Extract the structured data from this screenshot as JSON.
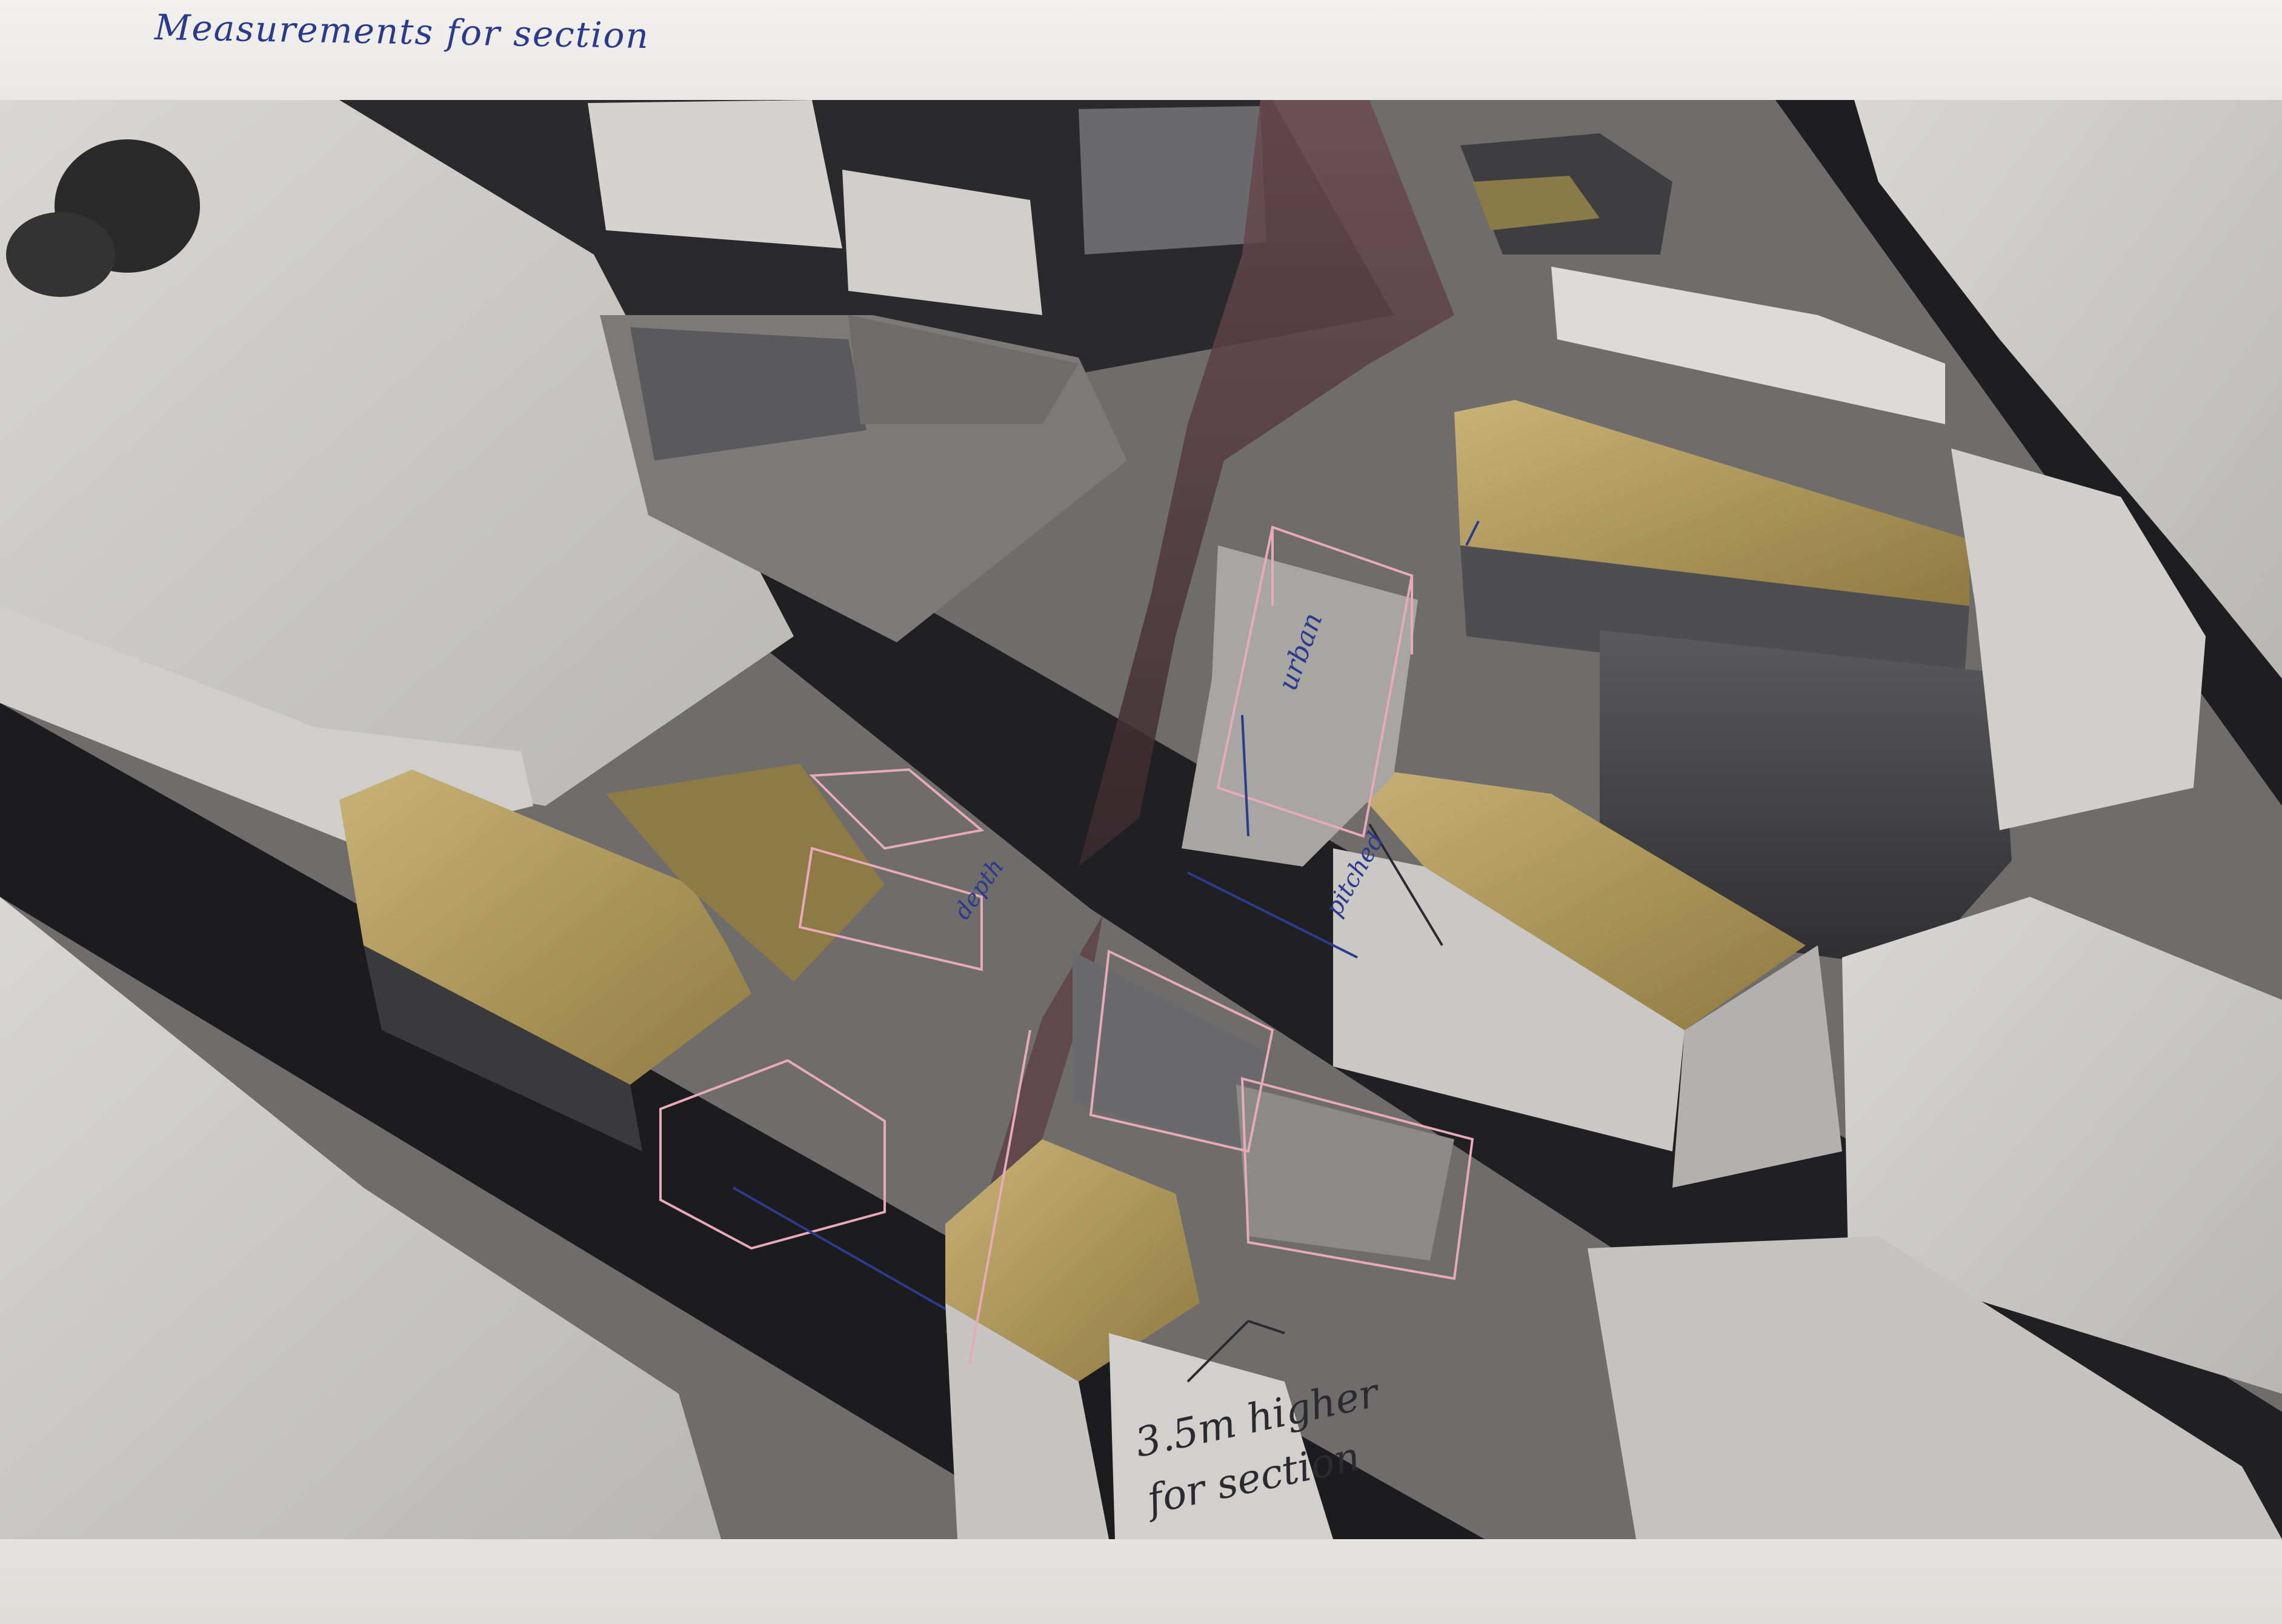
{
  "handwriting": {
    "title": "Measurements for section",
    "height_note": "3.5m higher for section",
    "dimension_urban": "urban",
    "dimension_depth": "depth",
    "dimension_angle": "pitched"
  },
  "colors": {
    "paper": "#ecebe8",
    "road": "#1c1c1e",
    "building_light": "#c9c8c5",
    "building_mid": "#8e8d8a",
    "building_dark": "#3a3a3c",
    "roof_highlight": "#b39a55",
    "lane_tint": "#5a3a40",
    "overlay_outline": "#e8a9b8",
    "ink_blue": "#2b3a8c"
  }
}
